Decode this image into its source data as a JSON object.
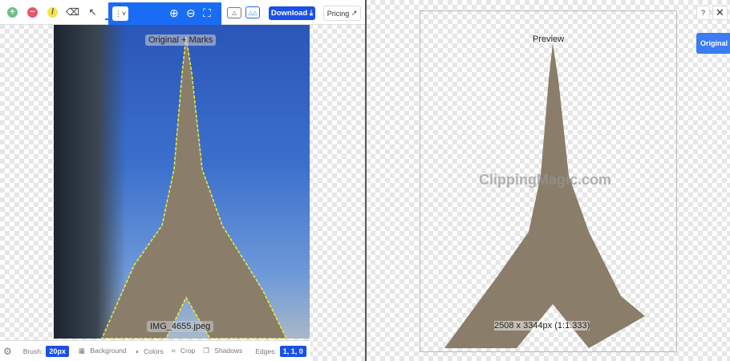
{
  "toolbar": {
    "tools": [
      "add-brush",
      "remove-brush",
      "highlight",
      "eraser",
      "select",
      "hand"
    ],
    "download_label": "Download",
    "pricing_label": "Pricing"
  },
  "left_view": {
    "label": "Original + Marks",
    "filename": "IMG_4655.jpeg"
  },
  "bottombar": {
    "brush_label": "Brush:",
    "brush_value": "20px",
    "background_label": "Background",
    "colors_label": "Colors",
    "crop_label": "Crop",
    "shadows_label": "Shadows",
    "edges_label": "Edges:",
    "edges_value": "1, 1, 0"
  },
  "right_view": {
    "label": "Preview",
    "watermark": "ClippingMagic.com",
    "dimensions": "2508 x 3344px (1:1.333)"
  },
  "right_buttons": {
    "help": "?",
    "original": "Original"
  },
  "colors": {
    "accent": "#1a6cf5",
    "add": "#6cc08a",
    "remove": "#e5576a",
    "highlight": "#f2e64a"
  }
}
